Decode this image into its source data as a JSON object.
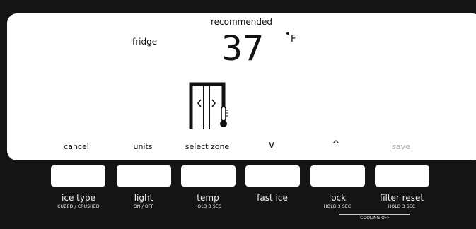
{
  "display": {
    "recommended": "recommended",
    "zone": "fridge",
    "temperature": "37",
    "unit": "F"
  },
  "soft_keys": [
    {
      "label": "cancel",
      "enabled": true
    },
    {
      "label": "units",
      "enabled": true
    },
    {
      "label": "select zone",
      "enabled": true
    },
    {
      "label": "v",
      "enabled": true
    },
    {
      "label": "^",
      "enabled": true
    },
    {
      "label": "save",
      "enabled": false
    }
  ],
  "buttons": [
    {
      "label": "ice type",
      "sub": "CUBED / CRUSHED"
    },
    {
      "label": "light",
      "sub": "ON / OFF"
    },
    {
      "label": "temp",
      "sub": "HOLD 3 SEC"
    },
    {
      "label": "fast ice",
      "sub": ""
    },
    {
      "label": "lock",
      "sub": "HOLD 3 SEC"
    },
    {
      "label": "filter reset",
      "sub": "HOLD 3 SEC"
    }
  ],
  "combo": {
    "label": "COOLING OFF"
  },
  "colors": {
    "background": "#141414",
    "panel": "#ffffff",
    "disabled": "#aaaaaa"
  }
}
